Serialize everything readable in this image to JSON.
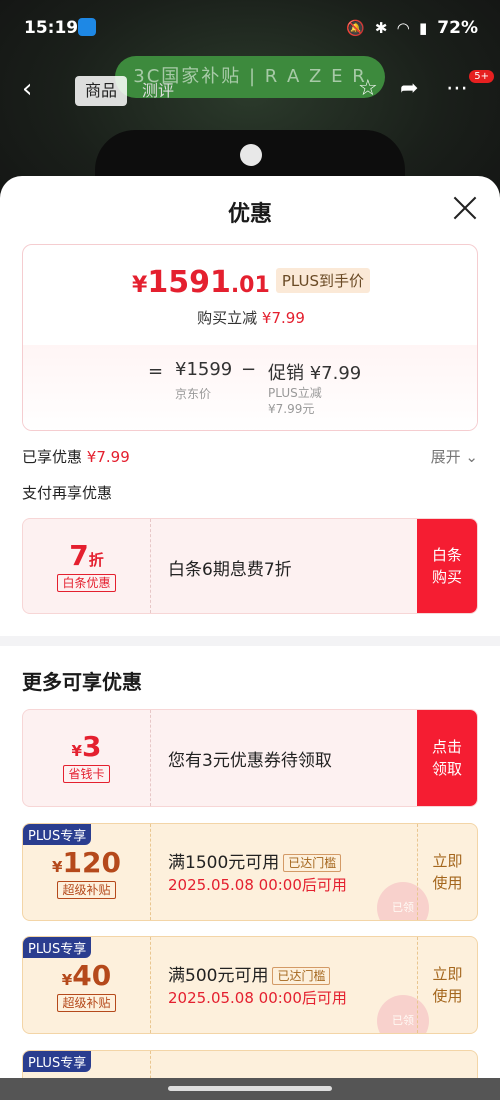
{
  "status_bar": {
    "time": "15:19",
    "battery": "72%"
  },
  "product_page": {
    "banner_text": "3C国家补贴 | R A Z E R",
    "tabs": [
      "商品",
      "测评"
    ],
    "cart_badge": "5+"
  },
  "sheet": {
    "title": "优惠",
    "price_card": {
      "final_price_yen": "¥",
      "final_price_int": "1591",
      "final_price_dec": ".01",
      "plus_label": "PLUS到手价",
      "instant_label": "购买立减",
      "instant_amount": "¥7.99",
      "equals": "=",
      "jd_price": "¥1599",
      "jd_label": "京东价",
      "minus": "−",
      "promo": "促销 ¥7.99",
      "promo_sub1": "PLUS立减",
      "promo_sub2": "¥7.99元"
    },
    "enjoyed_label": "已享优惠",
    "enjoyed_amount": "¥7.99",
    "expand_label": "展开",
    "pay_more_label": "支付再享优惠",
    "baitiao": {
      "amount": "7",
      "unit": "折",
      "tag": "白条优惠",
      "desc": "白条6期息费7折",
      "action": [
        "白条",
        "购买"
      ]
    },
    "more_title": "更多可享优惠",
    "savings_card": {
      "yen": "¥",
      "amount": "3",
      "tag": "省钱卡",
      "desc": "您有3元优惠券待领取",
      "action": [
        "点击",
        "领取"
      ]
    },
    "plus_coupons": [
      {
        "badge": "PLUS专享",
        "yen": "¥",
        "amount": "120",
        "tag": "超级补贴",
        "desc": "满1500元可用",
        "status": "已达门槛",
        "time": "2025.05.08 00:00后可用",
        "action": [
          "立即",
          "使用"
        ],
        "stamp": "已领"
      },
      {
        "badge": "PLUS专享",
        "yen": "¥",
        "amount": "40",
        "tag": "超级补贴",
        "desc": "满500元可用",
        "status": "已达门槛",
        "time": "2025.05.08 00:00后可用",
        "action": [
          "立即",
          "使用"
        ],
        "stamp": "已领"
      },
      {
        "badge": "PLUS专享"
      }
    ]
  },
  "colors": {
    "accent_red": "#e4202f",
    "plus_navy": "#2a3d8f",
    "gold_bg": "#fdf0dc"
  }
}
